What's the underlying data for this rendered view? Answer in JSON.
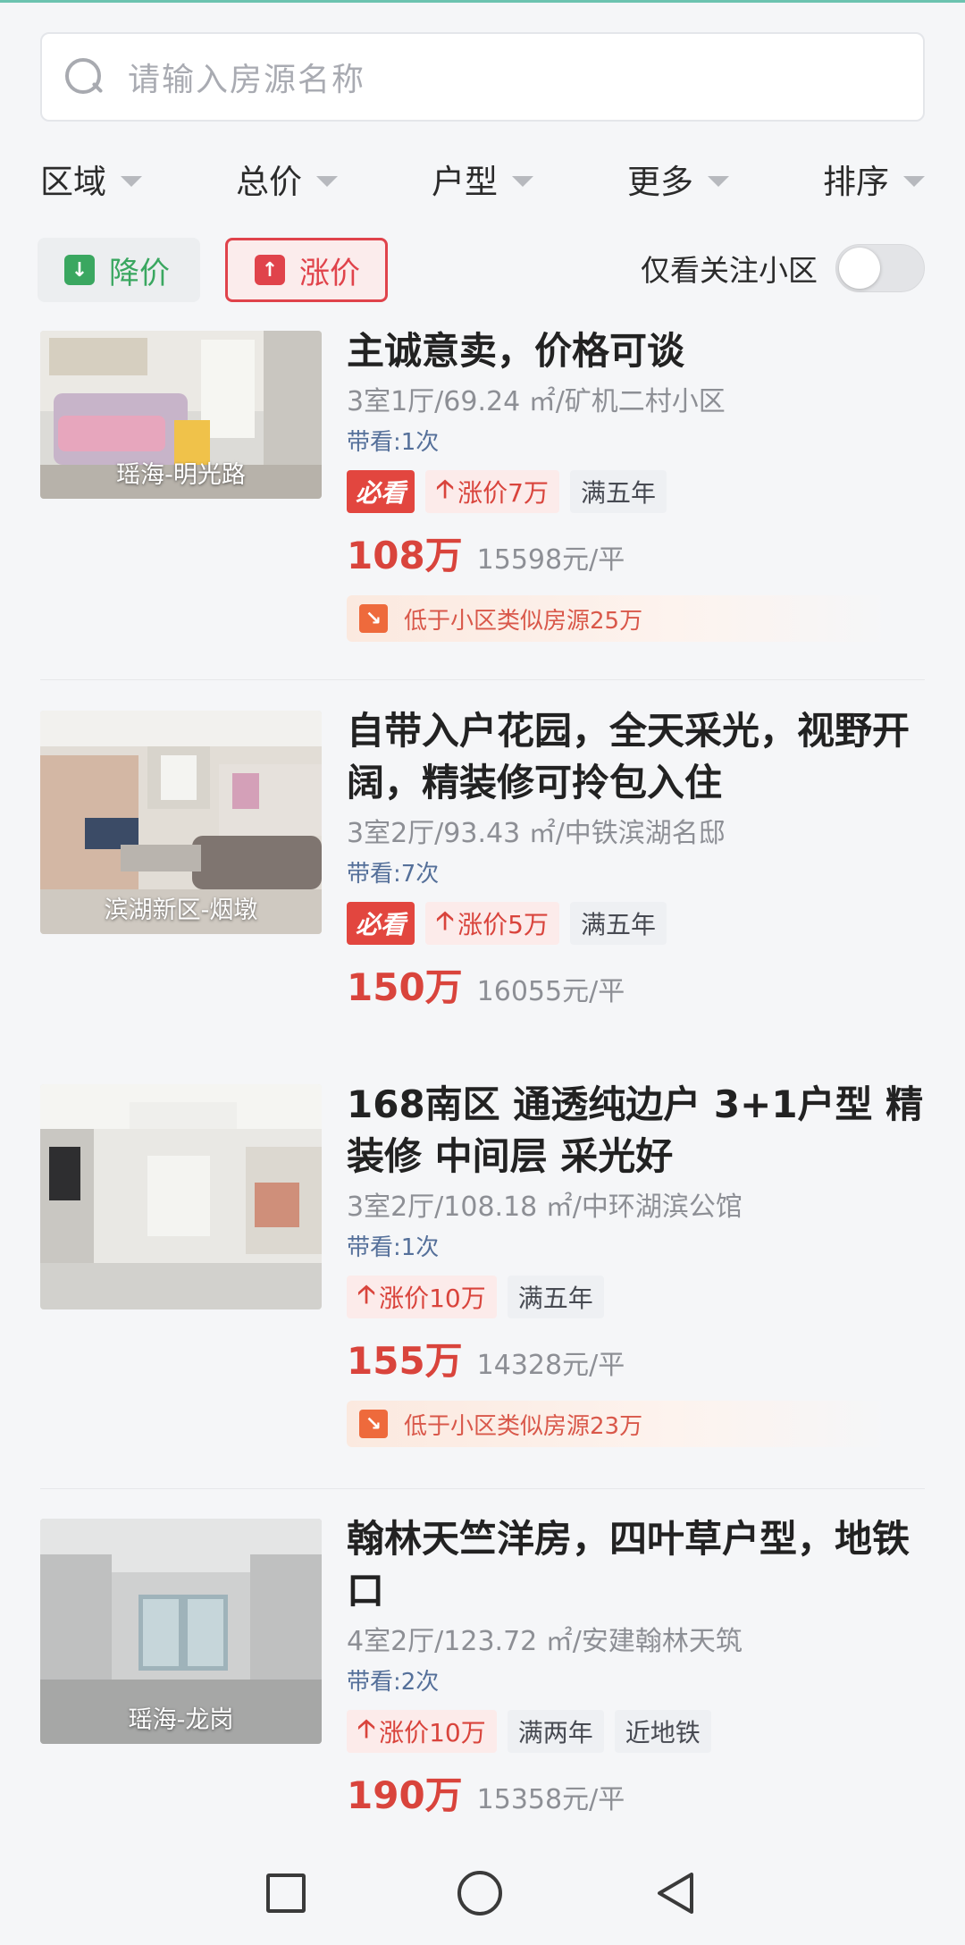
{
  "search": {
    "placeholder": "请输入房源名称"
  },
  "filters": [
    {
      "label": "区域"
    },
    {
      "label": "总价"
    },
    {
      "label": "户型"
    },
    {
      "label": "更多"
    },
    {
      "label": "排序"
    }
  ],
  "price_toggles": {
    "down_label": "降价",
    "up_label": "涨价"
  },
  "follow_toggle": {
    "label": "仅看关注小区",
    "on": false
  },
  "listings": [
    {
      "title": "主诚意卖，价格可谈",
      "meta": "3室1厅/69.24 ㎡/矿机二村小区",
      "views": "带看:1次",
      "location": "瑶海-明光路",
      "must_see": "必看",
      "rise": "涨价7万",
      "tags": [
        "满五年"
      ],
      "total": "108万",
      "unit_price": "15598元/平",
      "lower": "低于小区类似房源25万"
    },
    {
      "title": "自带入户花园，全天采光，视野开阔，精装修可拎包入住",
      "meta": "3室2厅/93.43 ㎡/中铁滨湖名邸",
      "views": "带看:7次",
      "location": "滨湖新区-烟墩",
      "must_see": "必看",
      "rise": "涨价5万",
      "tags": [
        "满五年"
      ],
      "total": "150万",
      "unit_price": "16055元/平"
    },
    {
      "title": "168南区 通透纯边户 3+1户型 精装修 中间层 采光好",
      "meta": "3室2厅/108.18 ㎡/中环湖滨公馆",
      "views": "带看:1次",
      "rise": "涨价10万",
      "tags": [
        "满五年"
      ],
      "total": "155万",
      "unit_price": "14328元/平",
      "lower": "低于小区类似房源23万"
    },
    {
      "title": "翰林天竺洋房，四叶草户型，地铁口",
      "meta": "4室2厅/123.72 ㎡/安建翰林天筑",
      "views": "带看:2次",
      "location": "瑶海-龙岗",
      "rise": "涨价10万",
      "tags": [
        "满两年",
        "近地铁"
      ],
      "total": "190万",
      "unit_price": "15358元/平"
    }
  ],
  "colors": {
    "accent_red": "#d9443c",
    "accent_green": "#3aa760"
  }
}
